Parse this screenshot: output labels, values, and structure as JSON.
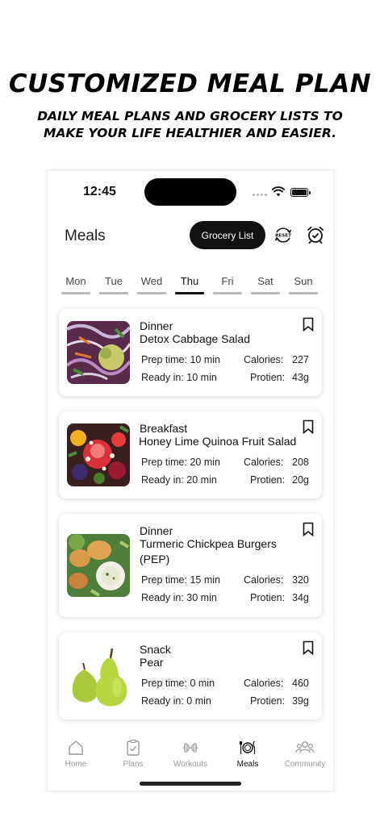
{
  "promo": {
    "headline": "CUSTOMIZED MEAL PLAN",
    "subline_1": "DAILY MEAL PLANS AND GROCERY LISTS TO",
    "subline_2": "MAKE YOUR LIFE HEALTHIER AND EASIER."
  },
  "status_bar": {
    "time": "12:45"
  },
  "header": {
    "title": "Meals",
    "grocery_button": "Grocery List",
    "reset_icon_text": "RESET",
    "reset_icon": "reset-icon",
    "alarm_icon": "alarm-check-icon"
  },
  "days": [
    {
      "label": "Mon",
      "active": false
    },
    {
      "label": "Tue",
      "active": false
    },
    {
      "label": "Wed",
      "active": false
    },
    {
      "label": "Thu",
      "active": true
    },
    {
      "label": "Fri",
      "active": false
    },
    {
      "label": "Sat",
      "active": false
    },
    {
      "label": "Sun",
      "active": false
    }
  ],
  "labels": {
    "prep": "Prep time:",
    "ready": "Ready in:",
    "calories": "Calories:",
    "protein": "Protien:"
  },
  "meals": [
    {
      "type": "Dinner",
      "name_1": "Detox Cabbage Salad",
      "name_2": "",
      "prep": "10 min",
      "ready": "10 min",
      "calories": "227",
      "protein": "43g",
      "image": "cabbage-salad-photo"
    },
    {
      "type": "Breakfast",
      "name_1": "Honey Lime Quinoa Fruit Salad",
      "name_2": "",
      "prep": "20 min",
      "ready": "20 min",
      "calories": "208",
      "protein": "20g",
      "image": "fruit-salad-photo"
    },
    {
      "type": "Dinner",
      "name_1": "Turmeric Chickpea Burgers",
      "name_2": "(PEP)",
      "prep": "15 min",
      "ready": "30 min",
      "calories": "320",
      "protein": "34g",
      "image": "chickpea-burgers-photo"
    },
    {
      "type": "Snack",
      "name_1": "Pear",
      "name_2": "",
      "prep": "0 min",
      "ready": "0 min",
      "calories": "460",
      "protein": "39g",
      "image": "pear-photo"
    }
  ],
  "tabbar": [
    {
      "label": "Home",
      "icon": "home-icon",
      "active": false
    },
    {
      "label": "Plans",
      "icon": "clipboard-check-icon",
      "active": false
    },
    {
      "label": "Workouts",
      "icon": "dumbbell-icon",
      "active": false
    },
    {
      "label": "Meals",
      "icon": "plate-cutlery-icon",
      "active": true
    },
    {
      "label": "Community",
      "icon": "people-icon",
      "active": false
    }
  ],
  "colors": {
    "accent": "#111111",
    "inactive": "#9a9a9a",
    "divider": "#b9b9b9",
    "card_bg": "#ffffff"
  }
}
